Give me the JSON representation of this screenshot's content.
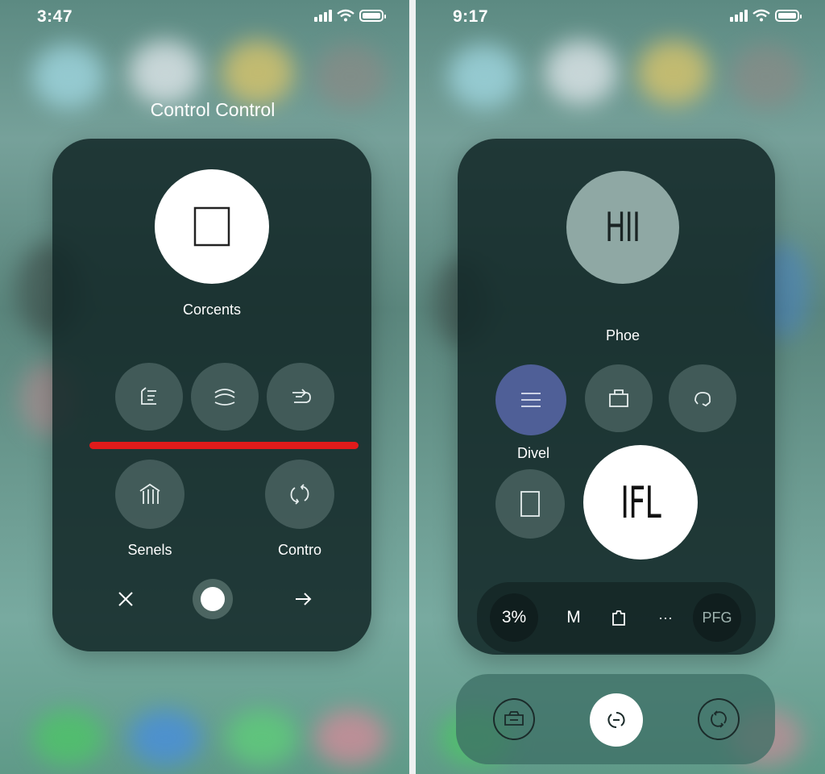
{
  "left": {
    "status_time": "3:47",
    "title": "Control Control",
    "main_label": "Corcents",
    "label_senels": "Senels",
    "label_contro": "Contro",
    "accent_line_color": "#e01b1b",
    "icons": [
      "stop-square-icon",
      "list-icon",
      "wave-icon",
      "repeat-icon",
      "signal-bars-icon",
      "sync-icon",
      "close-icon",
      "home-dot-icon",
      "arrow-right-icon"
    ]
  },
  "right": {
    "status_time": "9:17",
    "top_circle_text": "HII",
    "phone_label": "Phoe",
    "divel_label": "Divel",
    "white_circle_text": "IFL",
    "bar": {
      "percent": "3%",
      "m": "M",
      "more": "···",
      "pfg": "PFG"
    },
    "accent_color": "#4f5f97",
    "icons": [
      "menu-lines-icon",
      "briefcase-icon",
      "headphones-icon",
      "rectangle-icon",
      "clipboard-icon",
      "camera-icon",
      "rotate-icon",
      "refresh-icon"
    ]
  }
}
